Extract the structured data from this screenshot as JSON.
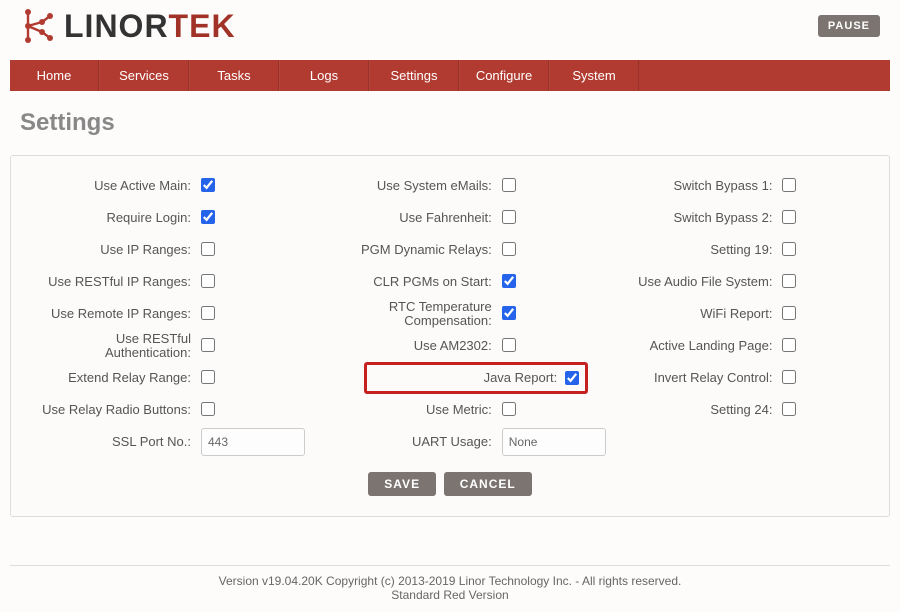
{
  "brand": {
    "text1": "LINOR",
    "text2": "TEK"
  },
  "pause_label": "PAUSE",
  "nav": [
    "Home",
    "Services",
    "Tasks",
    "Logs",
    "Settings",
    "Configure",
    "System"
  ],
  "page_title": "Settings",
  "col1": [
    {
      "label": "Use Active Main:",
      "type": "checkbox",
      "checked": true
    },
    {
      "label": "Require Login:",
      "type": "checkbox",
      "checked": true
    },
    {
      "label": "Use IP Ranges:",
      "type": "checkbox",
      "checked": false
    },
    {
      "label": "Use RESTful IP Ranges:",
      "type": "checkbox",
      "checked": false
    },
    {
      "label": "Use Remote IP Ranges:",
      "type": "checkbox",
      "checked": false
    },
    {
      "label": "Use RESTful Authentication:",
      "type": "checkbox",
      "checked": false
    },
    {
      "label": "Extend Relay Range:",
      "type": "checkbox",
      "checked": false
    },
    {
      "label": "Use Relay Radio Buttons:",
      "type": "checkbox",
      "checked": false
    },
    {
      "label": "SSL Port No.:",
      "type": "text",
      "value": "443"
    }
  ],
  "col2": [
    {
      "label": "Use System eMails:",
      "type": "checkbox",
      "checked": false
    },
    {
      "label": "Use Fahrenheit:",
      "type": "checkbox",
      "checked": false
    },
    {
      "label": "PGM Dynamic Relays:",
      "type": "checkbox",
      "checked": false
    },
    {
      "label": "CLR PGMs on Start:",
      "type": "checkbox",
      "checked": true
    },
    {
      "label": "RTC Temperature Compensation:",
      "type": "checkbox",
      "checked": true
    },
    {
      "label": "Use AM2302:",
      "type": "checkbox",
      "checked": false
    },
    {
      "label": "Java Report:",
      "type": "checkbox",
      "checked": true,
      "highlight": true
    },
    {
      "label": "Use Metric:",
      "type": "checkbox",
      "checked": false
    },
    {
      "label": "UART Usage:",
      "type": "text",
      "value": "None"
    }
  ],
  "col3": [
    {
      "label": "Switch Bypass 1:",
      "type": "checkbox",
      "checked": false
    },
    {
      "label": "Switch Bypass 2:",
      "type": "checkbox",
      "checked": false
    },
    {
      "label": "Setting 19:",
      "type": "checkbox",
      "checked": false
    },
    {
      "label": "Use Audio File System:",
      "type": "checkbox",
      "checked": false
    },
    {
      "label": "WiFi Report:",
      "type": "checkbox",
      "checked": false
    },
    {
      "label": "Active Landing Page:",
      "type": "checkbox",
      "checked": false
    },
    {
      "label": "Invert Relay Control:",
      "type": "checkbox",
      "checked": false
    },
    {
      "label": "Setting 24:",
      "type": "checkbox",
      "checked": false
    }
  ],
  "buttons": {
    "save": "SAVE",
    "cancel": "CANCEL"
  },
  "footer": {
    "line1": "Version v19.04.20K Copyright (c) 2013-2019 Linor Technology Inc. - All rights reserved.",
    "line2": "Standard Red Version"
  }
}
